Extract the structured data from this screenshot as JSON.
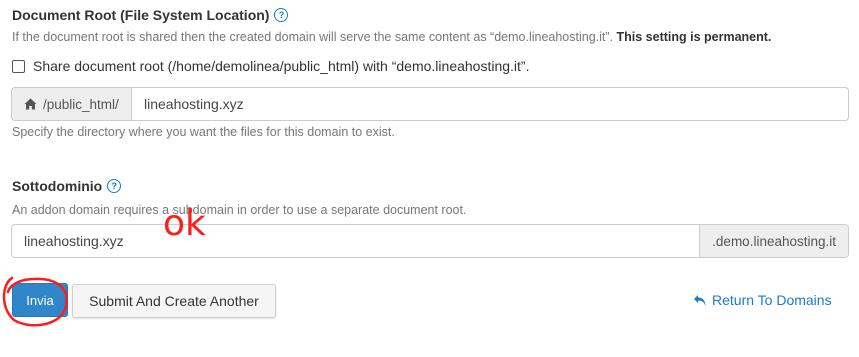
{
  "docroot": {
    "title": "Document Root (File System Location)",
    "help_icon": "question-circle-icon",
    "description_prefix": "If the document root is shared then the created domain will serve the same content as “demo.lineahosting.it”.",
    "description_bold": "This setting is permanent.",
    "share_checkbox_label": "Share document root (/home/demolinea/public_html) with “demo.lineahosting.it”.",
    "share_checked": false,
    "path_prefix": "/public_html/",
    "path_value": "lineahosting.xyz",
    "path_help": "Specify the directory where you want the files for this domain to exist."
  },
  "subdomain": {
    "title": "Sottodominio",
    "help_icon": "question-circle-icon",
    "description": "An addon domain requires a subdomain in order to use a separate document root.",
    "value": "lineahosting.xyz",
    "suffix": ".demo.lineahosting.it"
  },
  "actions": {
    "submit_label": "Invia",
    "submit_another_label": "Submit And Create Another",
    "return_label": "Return To Domains"
  },
  "annotation": {
    "text": "ok",
    "color": "#ff1c1c"
  },
  "colors": {
    "primary": "#2f86c9",
    "link": "#1d7ad0"
  }
}
